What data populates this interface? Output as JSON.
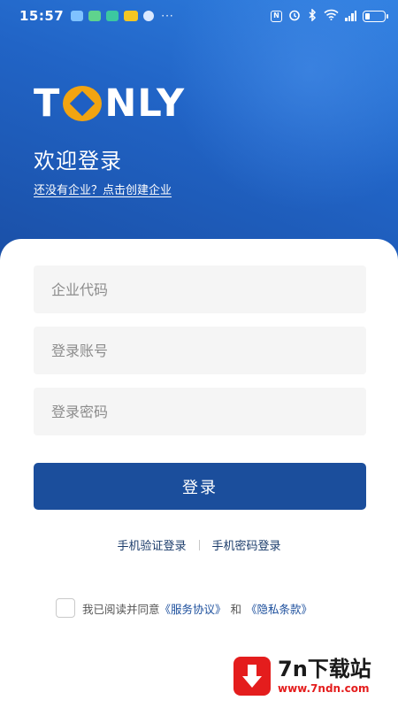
{
  "status_bar": {
    "time": "15:57",
    "more_indicator": "···",
    "nfc_icon": "N",
    "icons": [
      "nfc-icon",
      "alarm-icon",
      "bluetooth-icon",
      "wifi-icon",
      "signal-icon",
      "battery-icon"
    ],
    "battery_level": 0.25
  },
  "hero": {
    "logo_before": "T",
    "logo_after": "NLY",
    "welcome_title": "欢迎登录",
    "create_company_link": "还没有企业？点击创建企业"
  },
  "form": {
    "company_code_placeholder": "企业代码",
    "account_placeholder": "登录账号",
    "password_placeholder": "登录密码",
    "login_button": "登录"
  },
  "alt_login": {
    "sms_login": "手机验证登录",
    "phone_password_login": "手机密码登录"
  },
  "agreement": {
    "checked": false,
    "prefix": "我已阅读并同意",
    "service_agreement": "《服务协议》",
    "conjunction": "和",
    "privacy_policy": "《隐私条款》"
  },
  "watermark": {
    "title": "7n下载站",
    "url": "www.7ndn.com"
  },
  "colors": {
    "hero_top": "#2f7fe0",
    "hero_bottom": "#1a4fa6",
    "primary_button": "#1b4e9c",
    "logo_accent": "#f2a411",
    "watermark_red": "#e41d1d"
  }
}
